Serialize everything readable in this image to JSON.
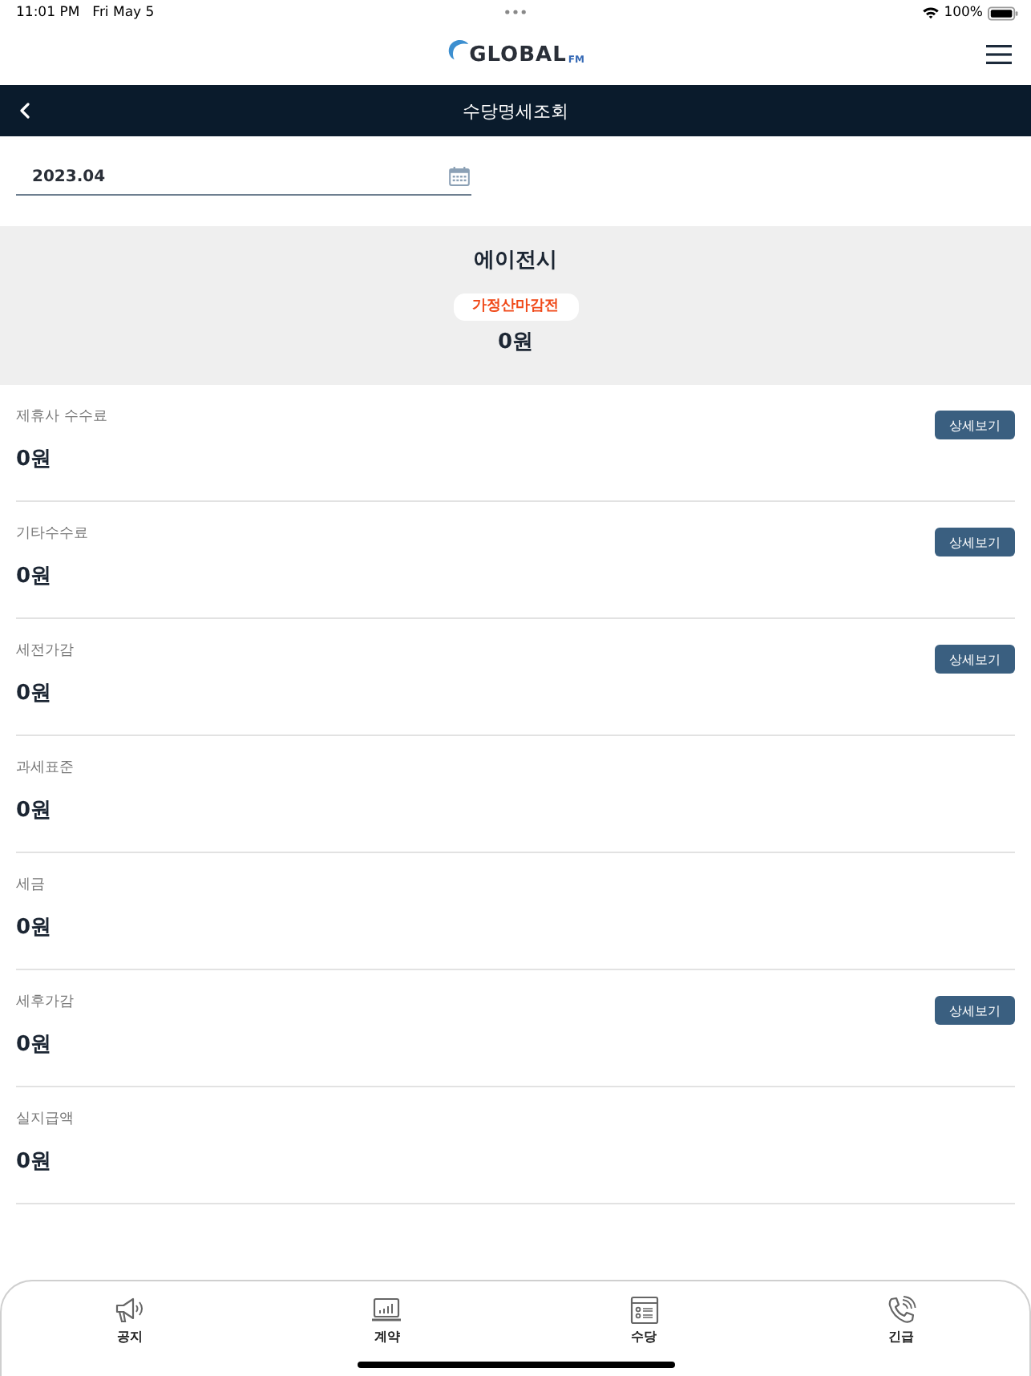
{
  "status_bar": {
    "time": "11:01 PM",
    "date": "Fri May 5",
    "battery": "100%"
  },
  "header": {
    "logo": {
      "text": "GLOBAL",
      "suffix": "FM"
    }
  },
  "nav_bar": {
    "title": "수당명세조회"
  },
  "month_field": {
    "value": "2023.04"
  },
  "summary": {
    "title": "에이전시",
    "badge": "가정산마감전",
    "amount": "0원"
  },
  "items": [
    {
      "label": "제휴사 수수료",
      "amount": "0원",
      "button": "상세보기"
    },
    {
      "label": "기타수수료",
      "amount": "0원",
      "button": "상세보기"
    },
    {
      "label": "세전가감",
      "amount": "0원",
      "button": "상세보기"
    },
    {
      "label": "과세표준",
      "amount": "0원"
    },
    {
      "label": "세금",
      "amount": "0원"
    },
    {
      "label": "세후가감",
      "amount": "0원",
      "button": "상세보기"
    },
    {
      "label": "실지급액",
      "amount": "0원"
    }
  ],
  "tab_bar": [
    {
      "kind": "megaphone",
      "label": "공지"
    },
    {
      "kind": "chart",
      "label": "계약"
    },
    {
      "kind": "list",
      "label": "수당"
    },
    {
      "kind": "phone",
      "label": "긴급"
    }
  ]
}
